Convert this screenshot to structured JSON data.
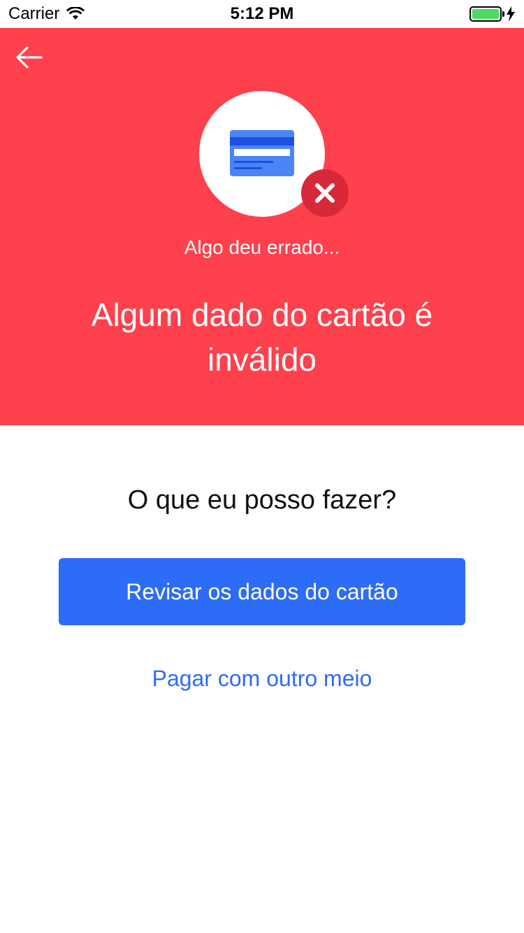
{
  "status_bar": {
    "carrier": "Carrier",
    "time": "5:12 PM",
    "battery_level": 1.0
  },
  "header": {
    "background_color": "#ff404d",
    "back_icon": "arrow-left-icon",
    "subtitle": "Algo deu errado...",
    "title": "Algum dado do cartão é inválido",
    "illustration_icon": "credit-card-icon",
    "badge_icon": "close-icon"
  },
  "body": {
    "question": "O que eu posso fazer?",
    "primary_button_label": "Revisar os dados do cartão",
    "secondary_link_label": "Pagar com outro meio",
    "accent_color": "#2d6cf6"
  }
}
